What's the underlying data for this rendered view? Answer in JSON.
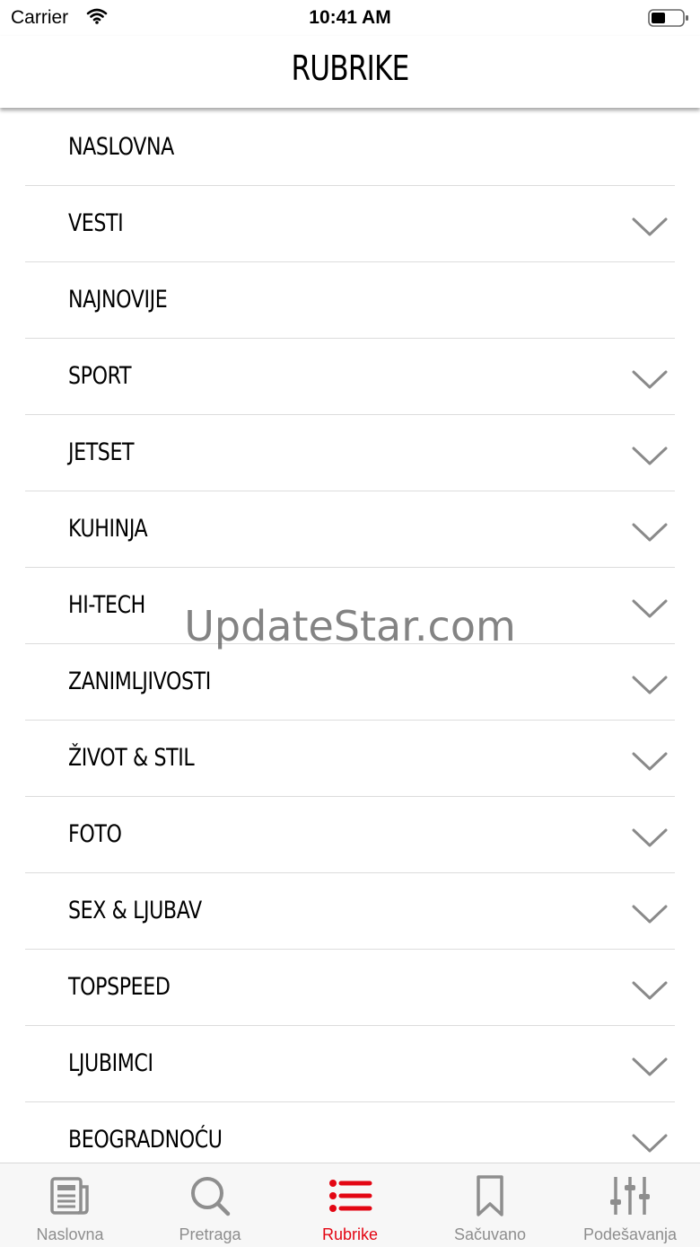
{
  "status_bar": {
    "carrier": "Carrier",
    "time": "10:41 AM"
  },
  "nav": {
    "title": "RUBRIKE"
  },
  "sections": [
    {
      "label": "NASLOVNA",
      "expandable": false
    },
    {
      "label": "VESTI",
      "expandable": true
    },
    {
      "label": "NAJNOVIJE",
      "expandable": false
    },
    {
      "label": "SPORT",
      "expandable": true
    },
    {
      "label": "JETSET",
      "expandable": true
    },
    {
      "label": "KUHINJA",
      "expandable": true
    },
    {
      "label": "HI-TECH",
      "expandable": true
    },
    {
      "label": "ZANIMLJIVOSTI",
      "expandable": true
    },
    {
      "label": "ŽIVOT & STIL",
      "expandable": true
    },
    {
      "label": "FOTO",
      "expandable": true
    },
    {
      "label": "SEX & LJUBAV",
      "expandable": true
    },
    {
      "label": "TOPSPEED",
      "expandable": true
    },
    {
      "label": "LJUBIMCI",
      "expandable": true
    },
    {
      "label": "BEOGRADNOĆU",
      "expandable": true
    }
  ],
  "watermark": "UpdateStar.com",
  "tabs": [
    {
      "label": "Naslovna",
      "icon": "newspaper-icon",
      "active": false
    },
    {
      "label": "Pretraga",
      "icon": "search-icon",
      "active": false
    },
    {
      "label": "Rubrike",
      "icon": "list-icon",
      "active": true
    },
    {
      "label": "Sačuvano",
      "icon": "bookmark-icon",
      "active": false
    },
    {
      "label": "Podešavanja",
      "icon": "sliders-icon",
      "active": false
    }
  ],
  "colors": {
    "accent": "#e30613",
    "inactive": "#8e8e8e",
    "chevron": "#8a8a8a"
  }
}
